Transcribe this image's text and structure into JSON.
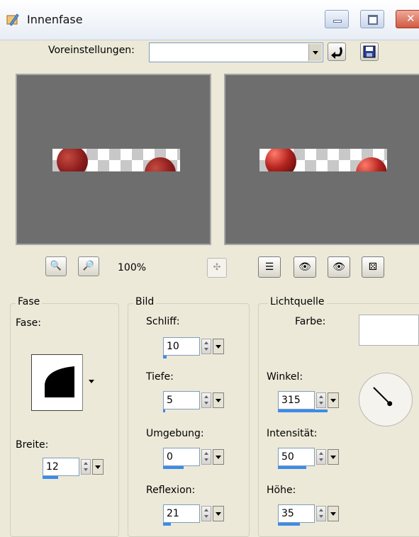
{
  "window": {
    "title": "Innenfase"
  },
  "presets": {
    "label": "Voreinstellungen:",
    "value": ""
  },
  "zoom": {
    "level": "100%"
  },
  "bevel": {
    "group_label": "Fase",
    "shape_label": "Fase:",
    "width_label": "Breite:",
    "width_value": "12",
    "width_fraction": 0.42
  },
  "image": {
    "group_label": "Bild",
    "smoothness_label": "Schliff:",
    "smoothness_value": "10",
    "smoothness_fraction": 0.1,
    "depth_label": "Tiefe:",
    "depth_value": "5",
    "depth_fraction": 0.05,
    "ambience_label": "Umgebung:",
    "ambience_value": "0",
    "ambience_fraction": 0.55,
    "reflection_label": "Reflexion:",
    "reflection_value": "21",
    "reflection_fraction": 0.21
  },
  "light": {
    "group_label": "Lichtquelle",
    "color_label": "Farbe:",
    "color_value": "#ffffff",
    "angle_label": "Winkel:",
    "angle_value": "315",
    "angle_fraction": 0.875,
    "intensity_label": "Intensität:",
    "intensity_value": "50",
    "intensity_fraction": 0.5,
    "height_label": "Höhe:",
    "height_value": "35",
    "height_fraction": 0.39
  },
  "colors": {
    "dome": "#8b1c1c",
    "preview_bg": "#6e6e6e",
    "slider": "#3d8be8"
  }
}
